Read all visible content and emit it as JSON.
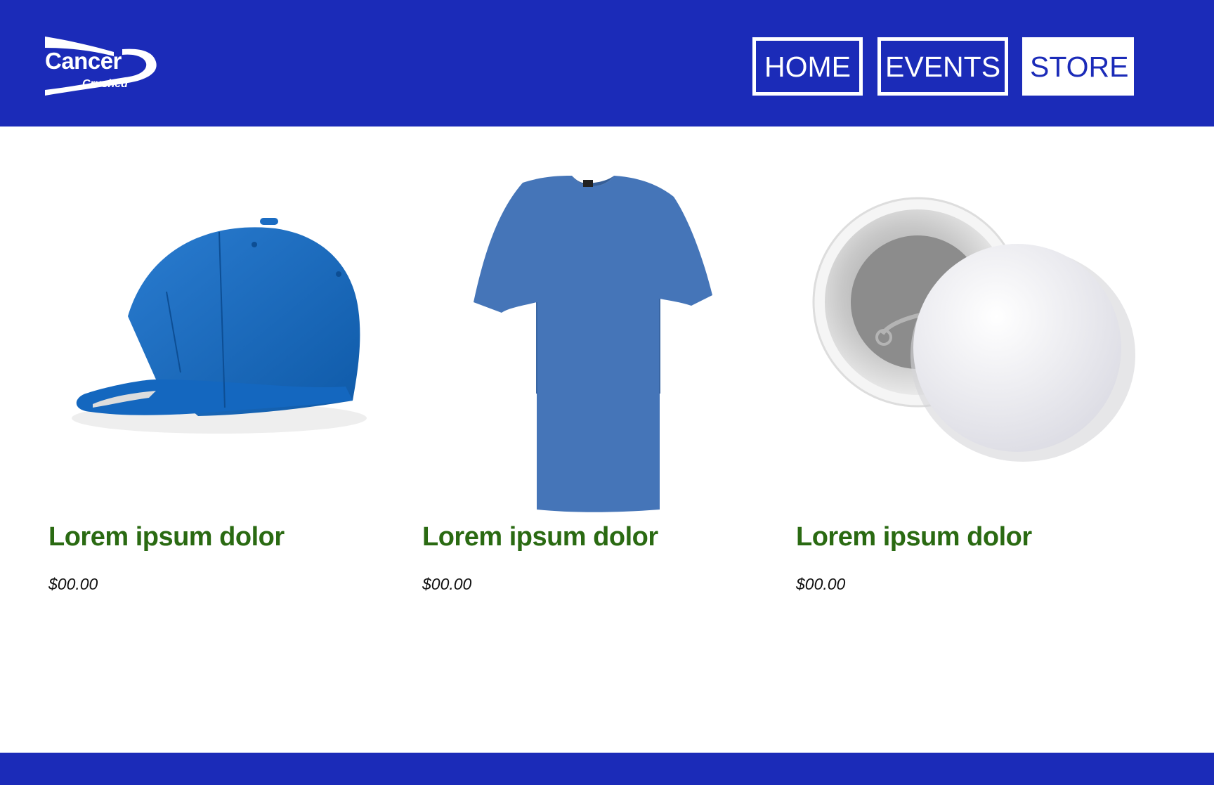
{
  "brand": {
    "name": "Cancer",
    "tagline": "Crushed",
    "color_primary": "#1b2bb8",
    "color_title": "#2a6a12"
  },
  "nav": {
    "items": [
      {
        "label": "HOME",
        "active": false
      },
      {
        "label": "EVENTS",
        "active": false
      },
      {
        "label": "STORE",
        "active": true
      }
    ]
  },
  "products": [
    {
      "name": "Lorem ipsum dolor",
      "price": "$00.00",
      "image": "blue-baseball-cap"
    },
    {
      "name": "Lorem ipsum dolor",
      "price": "$00.00",
      "image": "blue-t-shirt"
    },
    {
      "name": "Lorem ipsum dolor",
      "price": "$00.00",
      "image": "pin-button"
    }
  ]
}
